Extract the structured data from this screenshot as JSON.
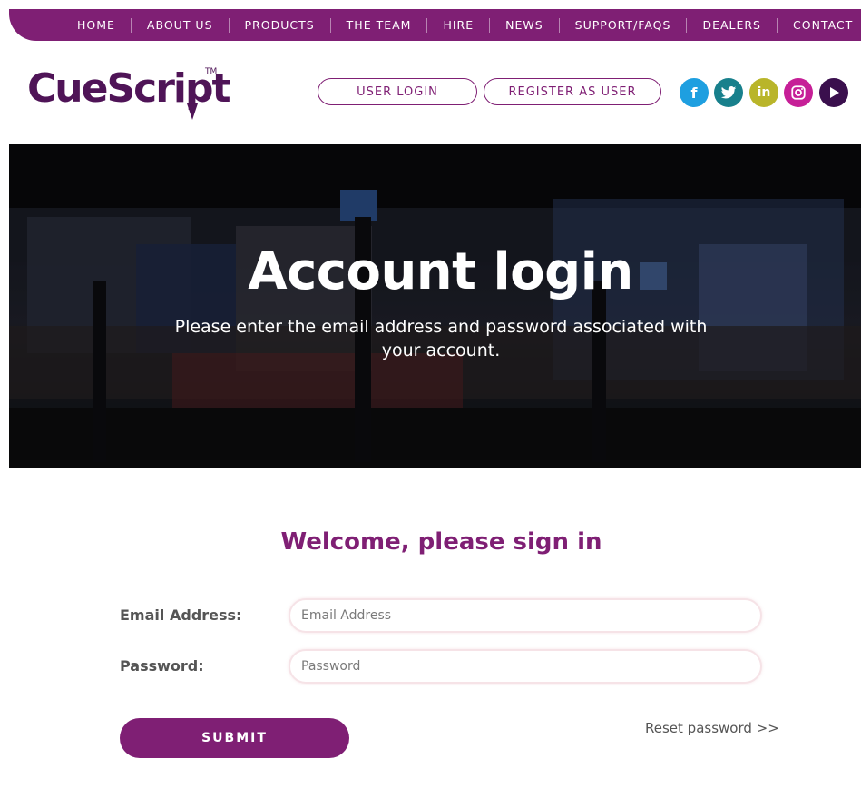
{
  "nav": {
    "items": [
      "HOME",
      "ABOUT US",
      "PRODUCTS",
      "THE TEAM",
      "HIRE",
      "NEWS",
      "SUPPORT/FAQS",
      "DEALERS",
      "CONTACT"
    ]
  },
  "header": {
    "logo_text": "CueScript",
    "logo_tm": "TM",
    "user_login": "USER LOGIN",
    "register": "REGISTER AS USER"
  },
  "social": [
    {
      "icon": "facebook-icon",
      "glyph": "f",
      "color": "#1e9fe0"
    },
    {
      "icon": "twitter-icon",
      "glyph": "t",
      "color": "#18808c"
    },
    {
      "icon": "linkedin-icon",
      "glyph": "in",
      "color": "#b9b52a"
    },
    {
      "icon": "instagram-icon",
      "glyph": "ig",
      "color": "#c61f97"
    },
    {
      "icon": "play-icon",
      "glyph": "▶",
      "color": "#3a0f4d"
    }
  ],
  "hero": {
    "title": "Account login",
    "subtitle": "Please enter the email address and password associated with your account."
  },
  "form": {
    "heading": "Welcome, please sign in",
    "email_label": "Email Address:",
    "email_placeholder": "Email Address",
    "password_label": "Password:",
    "password_placeholder": "Password",
    "submit": "SUBMIT",
    "reset": "Reset password >>"
  },
  "colors": {
    "brand_purple": "#7f1f74",
    "logo_purple": "#4f1457"
  }
}
